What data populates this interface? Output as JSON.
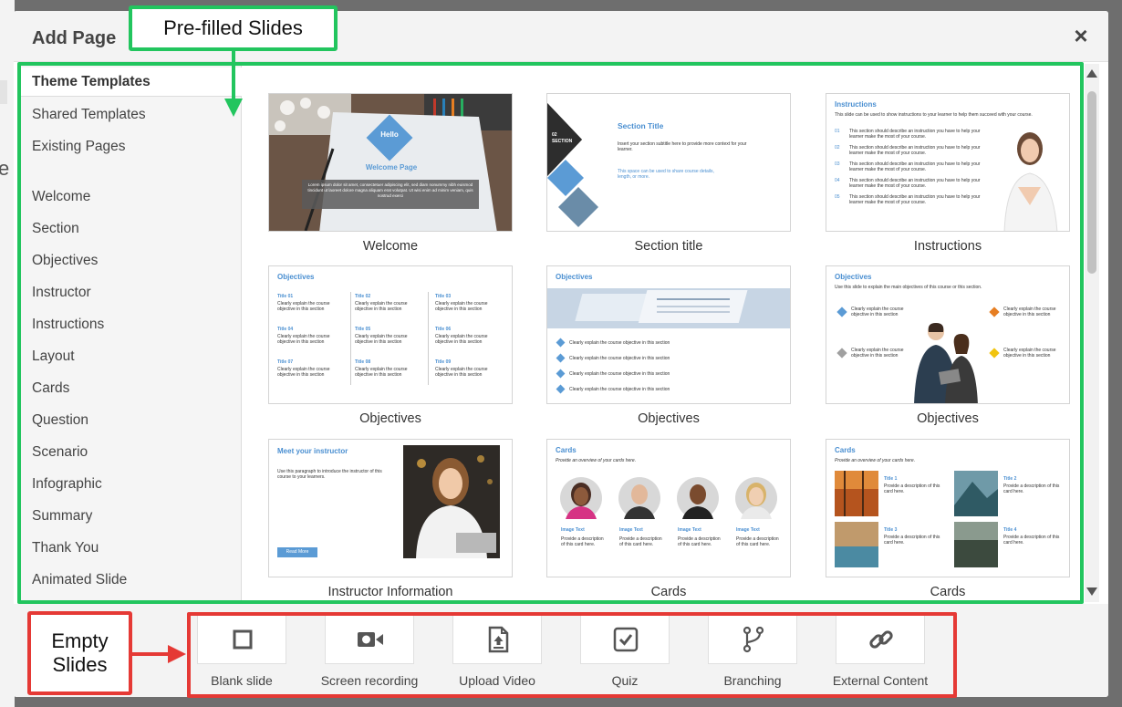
{
  "modal": {
    "title": "Add Page"
  },
  "background": {
    "partial_letter": "e"
  },
  "sidebar": {
    "items": [
      {
        "label": "Theme Templates"
      },
      {
        "label": "Shared Templates"
      },
      {
        "label": "Existing Pages"
      },
      {
        "label": "Welcome"
      },
      {
        "label": "Section"
      },
      {
        "label": "Objectives"
      },
      {
        "label": "Instructor"
      },
      {
        "label": "Instructions"
      },
      {
        "label": "Layout"
      },
      {
        "label": "Cards"
      },
      {
        "label": "Question"
      },
      {
        "label": "Scenario"
      },
      {
        "label": "Infographic"
      },
      {
        "label": "Summary"
      },
      {
        "label": "Thank You"
      },
      {
        "label": "Animated Slide"
      }
    ]
  },
  "templates": [
    {
      "label": "Welcome",
      "badge": "Hello",
      "heading": "Welcome Page",
      "body": "Lorem ipsum dolor sit amet, consectetuer adipiscing elit, sed diam nonummy nibh euismod tincidunt ut laoreet dolore magna aliquam erat volutpat. Ut wisi enim ad minim veniam, quis nostrud exerci"
    },
    {
      "label": "Section title",
      "heading": "Section Title",
      "number": "02",
      "tag": "SECTION",
      "body": "Insert your section subtitle here to provide more context for your learner.",
      "note": "This space can be used to share course details, length, or more."
    },
    {
      "label": "Instructions",
      "heading": "Instructions",
      "intro": "This slide can be used to show instructions to your learner to help them succeed with your course.",
      "numbers": [
        "01",
        "02",
        "03",
        "04",
        "05"
      ],
      "item_text": "This section should describe an instruction you have to help your learner make the most of your course."
    },
    {
      "label": "Objectives",
      "heading": "Objectives",
      "titles": [
        "Title 01",
        "Title 02",
        "Title 03",
        "Title 04",
        "Title 05",
        "Title 06",
        "Title 07",
        "Title 08",
        "Title 09"
      ],
      "item_text": "Clearly explain the course objective in this section"
    },
    {
      "label": "Objectives",
      "heading": "Objectives",
      "item_text": "Clearly explain the course objective in this section"
    },
    {
      "label": "Objectives",
      "heading": "Objectives",
      "intro": "Use this slide to explain the main objectives of this course or this section.",
      "item_text": "Clearly explain the course objective in this section"
    },
    {
      "label": "Instructor Information",
      "heading": "Meet your instructor",
      "body": "Use this paragraph to introduce the instructor of this course to your learners.",
      "button": "Read More"
    },
    {
      "label": "Cards",
      "heading": "Cards",
      "intro": "Provide an overview of your cards here.",
      "card_title": "Image Text",
      "card_text": "Provide a description of this card here."
    },
    {
      "label": "Cards",
      "heading": "Cards",
      "intro": "Provide an overview of your cards here.",
      "titles": [
        "Title 1",
        "Title 2",
        "Title 3",
        "Title 4"
      ],
      "card_text": "Provide a description of this card here."
    }
  ],
  "tools": [
    {
      "label": "Blank slide",
      "icon": "square-icon"
    },
    {
      "label": "Screen recording",
      "icon": "video-camera-icon"
    },
    {
      "label": "Upload Video",
      "icon": "file-upload-icon"
    },
    {
      "label": "Quiz",
      "icon": "checkbox-icon"
    },
    {
      "label": "Branching",
      "icon": "branch-icon"
    },
    {
      "label": "External Content",
      "icon": "link-icon"
    }
  ],
  "annotations": {
    "prefilled": "Pre-filled Slides",
    "empty_line1": "Empty",
    "empty_line2": "Slides"
  },
  "colors": {
    "accent_green": "#22c55e",
    "accent_red": "#e53935",
    "template_blue": "#4a8fd1"
  }
}
